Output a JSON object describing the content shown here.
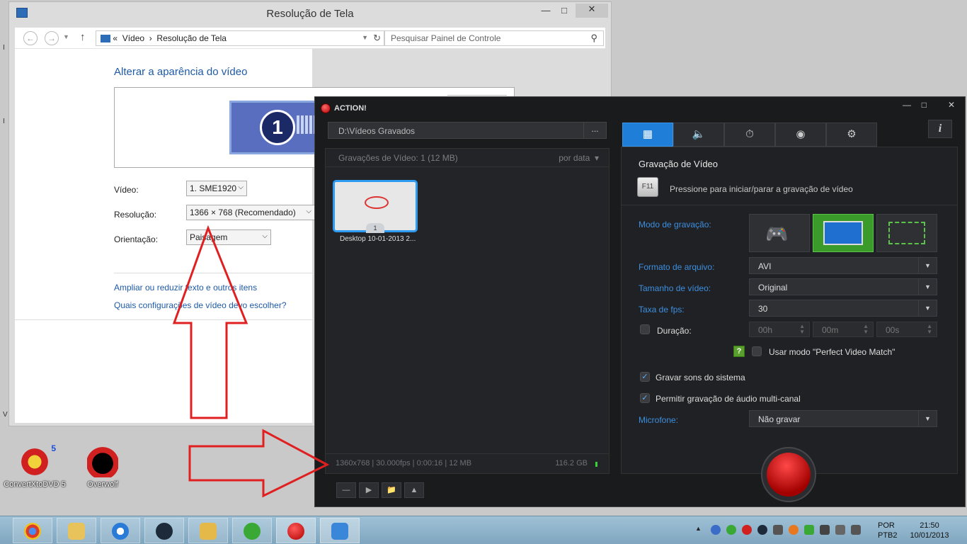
{
  "control_panel": {
    "window_title": "Resolução de Tela",
    "breadcrumb_prefix": "«",
    "breadcrumb_parent": "Vídeo",
    "breadcrumb_sep": "›",
    "breadcrumb_current": "Resolução de Tela",
    "search_placeholder": "Pesquisar Painel de Controle",
    "heading": "Alterar a aparência do vídeo",
    "monitor_number": "1",
    "fields": {
      "video_label": "Vídeo:",
      "video_value": "1. SME1920",
      "resolution_label": "Resolução:",
      "resolution_value": "1366 × 768 (Recomendado)",
      "orientation_label": "Orientação:",
      "orientation_value": "Paisagem"
    },
    "links": {
      "text_size": "Ampliar ou reduzir texto e outros itens",
      "which_settings": "Quais configurações de vídeo devo escolher?"
    }
  },
  "desktop": {
    "icons": [
      {
        "label": "ConvertXtoDVD 5",
        "badge": "5"
      },
      {
        "label": "Overwolf"
      }
    ]
  },
  "action": {
    "title": "ACTION!",
    "path": "D:\\Vídeos Gravados",
    "path_browse": "...",
    "recordings_header": "Gravações de Vídeo: 1 (12 MB)",
    "sort_label": "por data",
    "thumbnail_label": "Desktop 10-01-2013 2...",
    "thumbnail_number": "1",
    "footer_info": "1360x768 | 30.000fps | 0:00:16 | 12 MB",
    "footer_space": "116.2 GB",
    "info_button": "i",
    "tabs": [
      "video-tab",
      "audio-tab",
      "timer-tab",
      "screenshot-tab",
      "settings-tab"
    ],
    "panel": {
      "title": "Gravação de Vídeo",
      "hotkey": "F11",
      "hint": "Pressione para iniciar/parar a gravação de vídeo",
      "mode_label": "Modo de gravação:",
      "format_label": "Formato de arquivo:",
      "format_value": "AVI",
      "size_label": "Tamanho de vídeo:",
      "size_value": "Original",
      "fps_label": "Taxa de fps:",
      "fps_value": "30",
      "duration_label": "Duração:",
      "duration_h": "00h",
      "duration_m": "00m",
      "duration_s": "00s",
      "perfect_match_help": "?",
      "perfect_match_label": "Usar modo \"Perfect Video Match\"",
      "system_sounds_label": "Gravar sons do sistema",
      "multichannel_label": "Permitir gravação de áudio multi-canal",
      "mic_label": "Microfone:",
      "mic_value": "Não gravar"
    }
  },
  "taskbar": {
    "apps": [
      "chrome",
      "file-explorer",
      "itunes",
      "steam",
      "remote-desktop",
      "utorrent",
      "action-recorder",
      "control-panel"
    ],
    "language": "POR",
    "layout": "PTB2",
    "time": "21:50",
    "date": "10/01/2013"
  },
  "colors": {
    "accent_blue": "#1f7fd8",
    "link_blue": "#1e5aa8",
    "record_red": "#d40000",
    "annotation_red": "#e02020"
  }
}
